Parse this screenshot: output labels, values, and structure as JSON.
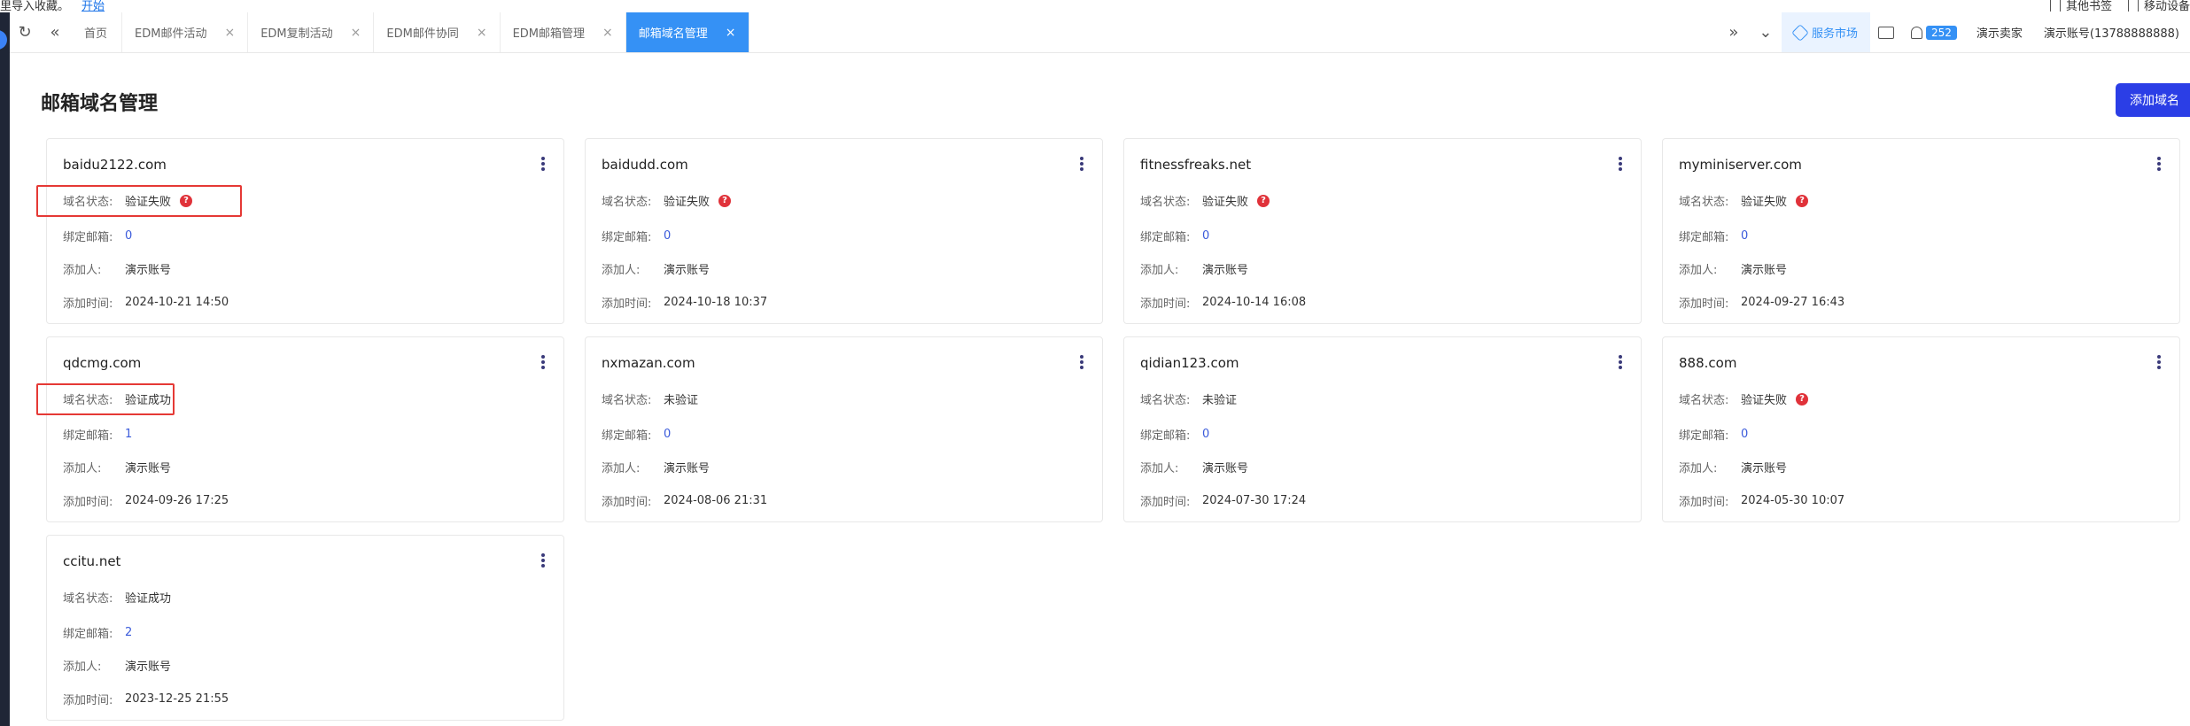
{
  "bookmarks": {
    "import_text": "里导入收藏。",
    "import_link": "开始",
    "other_bookmarks": "其他书签",
    "mobile_bookmarks": "移动设备"
  },
  "tabs": [
    {
      "label": "首页",
      "closable": false,
      "active": false
    },
    {
      "label": "EDM邮件活动",
      "closable": true,
      "active": false
    },
    {
      "label": "EDM复制活动",
      "closable": true,
      "active": false
    },
    {
      "label": "EDM邮件协同",
      "closable": true,
      "active": false
    },
    {
      "label": "EDM邮箱管理",
      "closable": true,
      "active": false
    },
    {
      "label": "邮箱域名管理",
      "closable": true,
      "active": true
    }
  ],
  "header_right": {
    "service_market": "服务市场",
    "notification_count": "252",
    "demo_seller": "演示卖家",
    "account": "演示账号(13788888888)"
  },
  "page": {
    "title": "邮箱域名管理",
    "add_button": "添加域名"
  },
  "labels": {
    "status": "域名状态:",
    "bound_email": "绑定邮箱:",
    "added_by": "添加人:",
    "added_time": "添加时间:"
  },
  "domains": [
    {
      "domain": "baidu2122.com",
      "status": "验证失败",
      "status_type": "fail",
      "bound": "0",
      "added_by": "演示账号",
      "time": "2024-10-21 14:50",
      "highlight": true
    },
    {
      "domain": "baidudd.com",
      "status": "验证失败",
      "status_type": "fail",
      "bound": "0",
      "added_by": "演示账号",
      "time": "2024-10-18 10:37",
      "highlight": false
    },
    {
      "domain": "fitnessfreaks.net",
      "status": "验证失败",
      "status_type": "fail",
      "bound": "0",
      "added_by": "演示账号",
      "time": "2024-10-14 16:08",
      "highlight": false
    },
    {
      "domain": "myminiserver.com",
      "status": "验证失败",
      "status_type": "fail",
      "bound": "0",
      "added_by": "演示账号",
      "time": "2024-09-27 16:43",
      "highlight": false
    },
    {
      "domain": "qdcmg.com",
      "status": "验证成功",
      "status_type": "ok",
      "bound": "1",
      "added_by": "演示账号",
      "time": "2024-09-26 17:25",
      "highlight": true
    },
    {
      "domain": "nxmazan.com",
      "status": "未验证",
      "status_type": "none",
      "bound": "0",
      "added_by": "演示账号",
      "time": "2024-08-06 21:31",
      "highlight": false
    },
    {
      "domain": "qidian123.com",
      "status": "未验证",
      "status_type": "none",
      "bound": "0",
      "added_by": "演示账号",
      "time": "2024-07-30 17:24",
      "highlight": false
    },
    {
      "domain": "888.com",
      "status": "验证失败",
      "status_type": "fail",
      "bound": "0",
      "added_by": "演示账号",
      "time": "2024-05-30 10:07",
      "highlight": false
    },
    {
      "domain": "ccitu.net",
      "status": "验证成功",
      "status_type": "ok",
      "bound": "2",
      "added_by": "演示账号",
      "time": "2023-12-25 21:55",
      "highlight": false
    }
  ],
  "colors": {
    "active_tab": "#3591f5",
    "primary_button": "#2b3ee6",
    "fail": "#e0323a",
    "success": "#2fb54a",
    "link_number": "#3b5bdb"
  }
}
